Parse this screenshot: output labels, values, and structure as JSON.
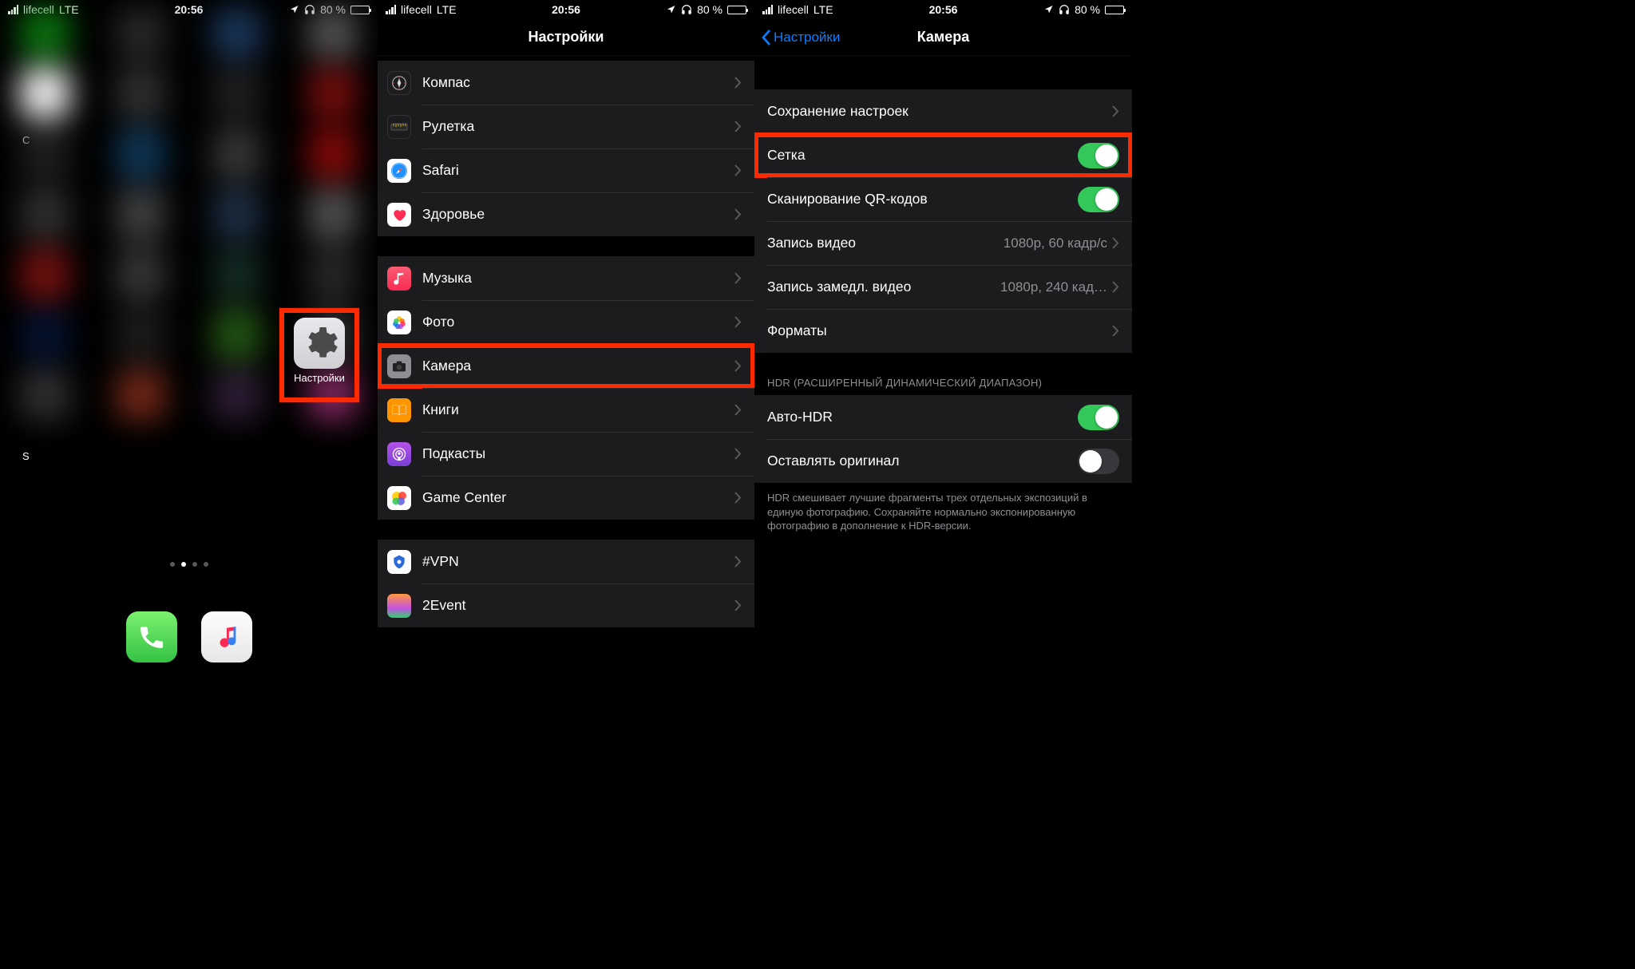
{
  "status": {
    "carrier": "lifecell",
    "network": "LTE",
    "time": "20:56",
    "battery_pct": "80 %"
  },
  "panel1": {
    "settings_app_label": "Настройки"
  },
  "panel2": {
    "title": "Настройки",
    "group1": {
      "compass": "Компас",
      "ruler": "Рулетка",
      "safari": "Safari",
      "health": "Здоровье"
    },
    "group2": {
      "music": "Музыка",
      "photos": "Фото",
      "camera": "Камера",
      "books": "Книги",
      "podcasts": "Подкасты",
      "gamecenter": "Game Center"
    },
    "group3": {
      "vpn": "#VPN",
      "event2": "2Event"
    }
  },
  "panel3": {
    "back": "Настройки",
    "title": "Камера",
    "preserve": "Сохранение настроек",
    "grid": "Сетка",
    "qr": "Сканирование QR-кодов",
    "video": "Запись видео",
    "video_val": "1080p, 60 кадр/с",
    "slomo": "Запись замедл. видео",
    "slomo_val": "1080p, 240 кад…",
    "formats": "Форматы",
    "hdr_header": "HDR (РАСШИРЕННЫЙ ДИНАМИЧЕСКИЙ ДИАПАЗОН)",
    "auto_hdr": "Авто-HDR",
    "keep_orig": "Оставлять оригинал",
    "hdr_footer": "HDR смешивает лучшие фрагменты трех отдельных экспозиций в единую фотографию. Сохраняйте нормально экспонированную фотографию в дополнение к HDR-версии."
  }
}
